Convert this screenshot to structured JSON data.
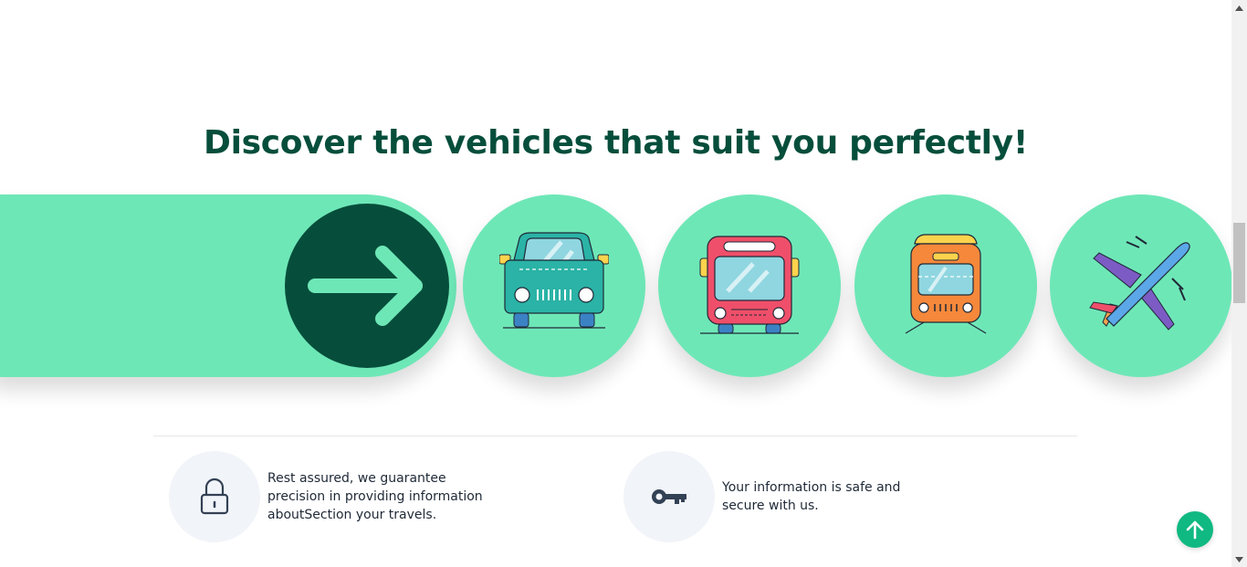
{
  "section": {
    "heading": "Discover the vehicles that suit you perfectly!"
  },
  "vehicles": [
    {
      "icon": "car-icon"
    },
    {
      "icon": "bus-icon"
    },
    {
      "icon": "train-icon"
    },
    {
      "icon": "airplane-icon"
    }
  ],
  "features": [
    {
      "icon": "padlock-icon",
      "text": "Rest assured, we guarantee precision in providing information aboutSection your travels."
    },
    {
      "icon": "key-icon",
      "text": "Your information is safe and secure with us."
    }
  ],
  "colors": {
    "accent_mint": "#6ee7b7",
    "dark_green": "#064e3b",
    "scroll_button": "#10b981"
  },
  "controls": {
    "next_icon": "arrow-right-icon",
    "scroll_top_icon": "arrow-up-icon"
  }
}
